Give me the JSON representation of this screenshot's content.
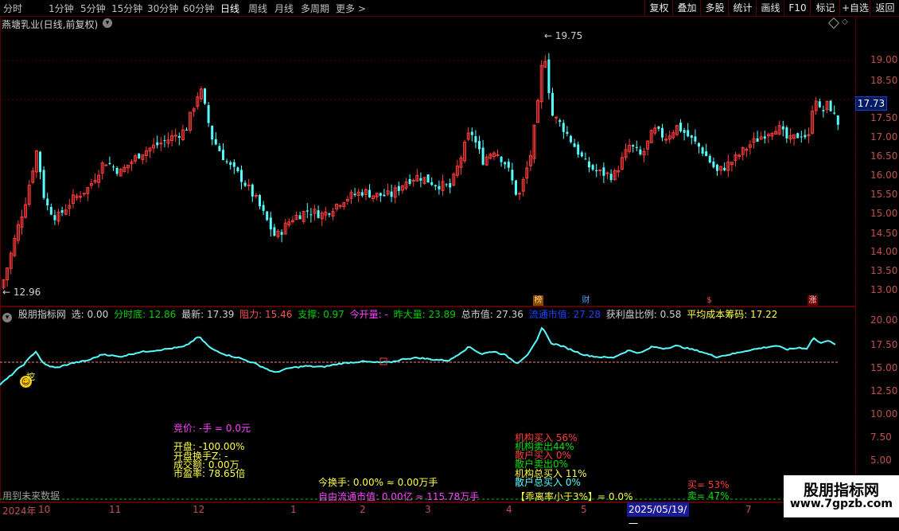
{
  "toolbar": {
    "periods": [
      "分时",
      "1分钟",
      "5分钟",
      "15分钟",
      "30分钟",
      "60分钟",
      "日线",
      "周线",
      "月线",
      "多周期",
      "更多 >"
    ],
    "active_period": "日线",
    "right_buttons": [
      "复权",
      "叠加",
      "多股",
      "统计",
      "画线",
      "F10",
      "标记",
      "+自选",
      "返回"
    ]
  },
  "chart_header": {
    "stock_title": "燕塘乳业(日线,前复权)"
  },
  "price_axis": [
    "19.00",
    "18.50",
    "18.00",
    "17.50",
    "17.00",
    "16.50",
    "16.00",
    "15.50",
    "15.00",
    "14.50",
    "14.00",
    "13.50",
    "13.00"
  ],
  "current_price_tag": "17.73",
  "price_annotations": {
    "high": "19.75",
    "low": "12.96"
  },
  "event_badges": [
    "榜",
    "财",
    "$",
    "涨"
  ],
  "indicator": {
    "name": "股朋指标网",
    "xuan": "选: 0.00",
    "fenshidi": "分时底: 12.86",
    "zuixin": "最新: 17.39",
    "zuli": "阻力: 15.46",
    "zhicheng": "支撑: 0.97",
    "jinkailiang": "今开量: -",
    "zuodaliang": "昨大量: 23.89",
    "zongshizhi": "总市值: 27.36",
    "liutong": "流通市值: 27.28",
    "huolipan": "获利盘比例: 0.58",
    "chengben": "平均成本筹码: 17.22"
  },
  "indicator_axis": [
    "20.00",
    "17.50",
    "15.00",
    "12.50",
    "10.00",
    "7.50",
    "5.00"
  ],
  "info": {
    "jingjia": "竞价: -手 = 0.0元",
    "kaipan": "开盘: -100.00%",
    "kaipan_huanshou": "开盘换手Z: -",
    "chengjiao": "成交额: 0.00万",
    "shiying": "市盈率: 78.65倍",
    "jinhuanshou": "今换手: 0.00% ≈ 0.00万手",
    "ziyou": "自由流通市值: 0.00亿 ≈ 115.78万手",
    "jigou_mairu": "机构买入 56%",
    "jigou_maichu": "机构卖出44%",
    "sanhu_mairu": "散户买入 0%",
    "sanhu_maichu": "散户卖出0%",
    "jigou_zong": "机构总买入 11%",
    "sanhu_zong": "散户总买入 0%",
    "guaili": "【乖离率小于3%】= 0.0%",
    "mai": "买= 53%",
    "mai2": "卖= 47%",
    "future_data": "用到未来数据",
    "wa": "挖"
  },
  "date_axis": {
    "labels": [
      "2024年",
      "10",
      "11",
      "12",
      "1",
      "2",
      "3",
      "4",
      "5",
      "6",
      "7"
    ],
    "selected": "2025/05/19/一"
  },
  "watermark": {
    "name": "股朋指标网",
    "url": "www.7gpzb.com"
  },
  "colors": {
    "up": "#ff3c3c",
    "down": "#54ffff",
    "axis": "#c0504d",
    "border": "#5a0000",
    "bg": "#000000"
  }
}
